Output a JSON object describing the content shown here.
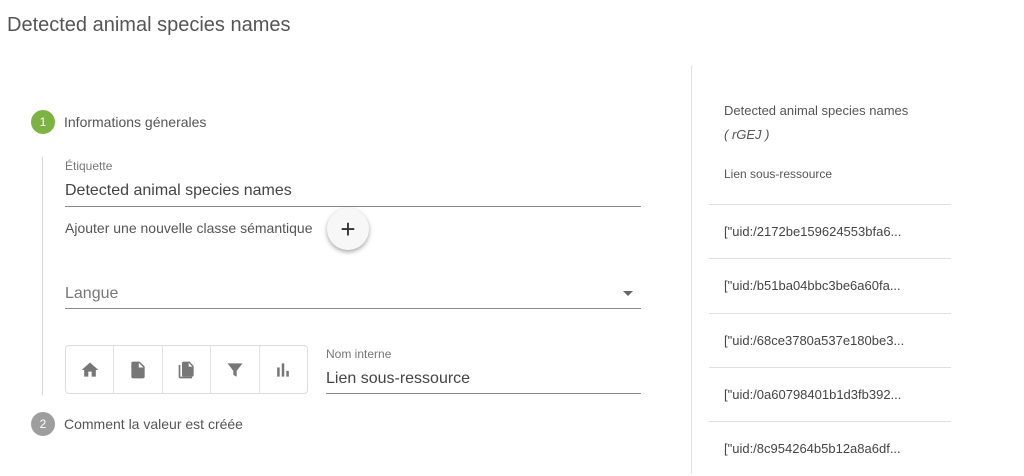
{
  "page": {
    "title": "Detected animal species names"
  },
  "steps": [
    {
      "number": "1",
      "label": "Informations génerales"
    },
    {
      "number": "2",
      "label": "Comment la valeur est créée"
    }
  ],
  "form": {
    "label_caption": "Étiquette",
    "label_value": "Detected animal species names",
    "add_semantic_text": "Ajouter une nouvelle classe sémantique",
    "add_button_symbol": "+",
    "language_placeholder": "Langue",
    "internal_name_caption": "Nom interne",
    "internal_name_value": "Lien sous-ressource"
  },
  "toolbar": {
    "icons": [
      "home-icon",
      "file-icon",
      "files-icon",
      "filter-icon",
      "bar-chart-icon"
    ]
  },
  "sidebar": {
    "title": "Detected animal species names",
    "subtitle": "( rGEJ )",
    "caption": "Lien sous-ressource",
    "rows": [
      "[\"uid:/2172be159624553bfa6...",
      "[\"uid:/b51ba04bbc3be6a60fa...",
      "[\"uid:/68ce3780a537e180be3...",
      "[\"uid:/0a60798401b1d3fb392...",
      "[\"uid:/8c954264b5b12a8a6df..."
    ]
  },
  "colors": {
    "step_active": "#7cb342",
    "step_inactive": "#9e9e9e"
  }
}
